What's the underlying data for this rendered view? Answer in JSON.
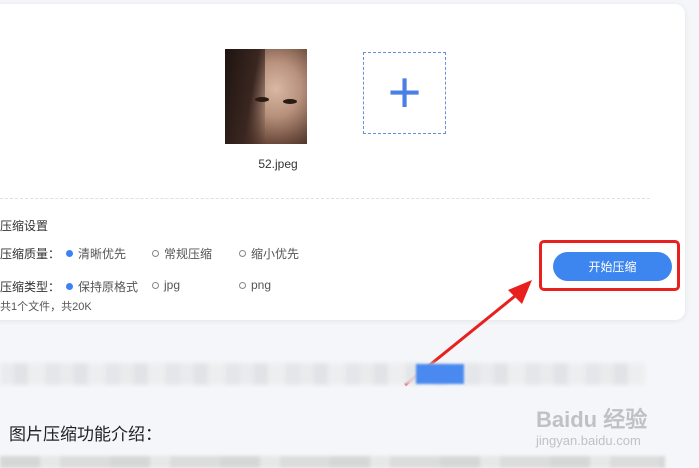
{
  "upload": {
    "file_name": "52.jpeg",
    "add_icon": "+"
  },
  "settings": {
    "title": "压缩设置",
    "quality": {
      "label": "压缩质量：",
      "options": [
        "清晰优先",
        "常规压缩",
        "缩小优先"
      ],
      "selected": "清晰优先"
    },
    "type": {
      "label": "压缩类型：",
      "options": [
        "保持原格式",
        "jpg",
        "png"
      ],
      "selected": "保持原格式"
    },
    "summary": "共1个文件，共20K"
  },
  "actions": {
    "start_label": "开始压缩"
  },
  "intro": {
    "title": "图片压缩功能介绍："
  },
  "watermark": {
    "brand": "Baidu 经验",
    "domain": "jingyan.baidu.com"
  },
  "colors": {
    "accent": "#3d86f0",
    "highlight": "#e8201e"
  }
}
